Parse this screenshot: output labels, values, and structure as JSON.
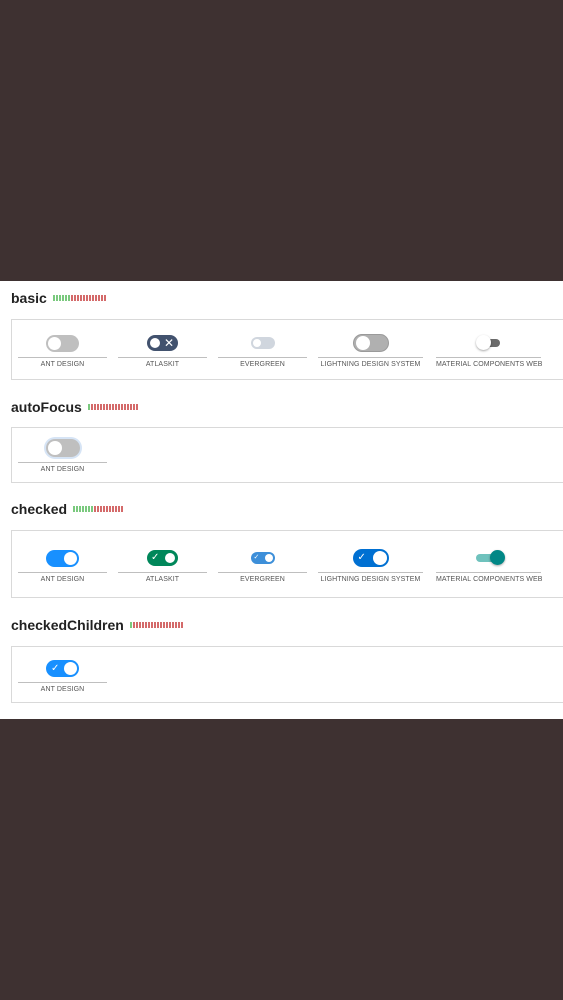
{
  "colors": {
    "bar_good": "#7ac97e",
    "bar_bad": "#d46a6a",
    "ant_blue": "#1890ff",
    "atlas_green": "#00875a",
    "atlas_dark": "#42526e",
    "evergreen_blue": "#47b881",
    "lightning_blue": "#0070d2",
    "material_teal": "#018786"
  },
  "sections": [
    {
      "title": "basic",
      "libraries": [
        "ANT DESIGN",
        "ATLASKIT",
        "EVERGREEN",
        "LIGHTNING DESIGN SYSTEM",
        "MATERIAL COMPONENTS WEB"
      ]
    },
    {
      "title": "autoFocus",
      "libraries": [
        "ANT DESIGN"
      ]
    },
    {
      "title": "checked",
      "libraries": [
        "ANT DESIGN",
        "ATLASKIT",
        "EVERGREEN",
        "LIGHTNING DESIGN SYSTEM",
        "MATERIAL COMPONENTS WEB"
      ]
    },
    {
      "title": "checkedChildren",
      "libraries": [
        "ANT DESIGN"
      ]
    }
  ],
  "icons": {
    "atlaskit_off": "x-icon",
    "atlaskit_on": "check-icon",
    "evergreen_on": "check-icon",
    "lightning_on": "check-icon",
    "ant_children_on": "check-icon"
  }
}
